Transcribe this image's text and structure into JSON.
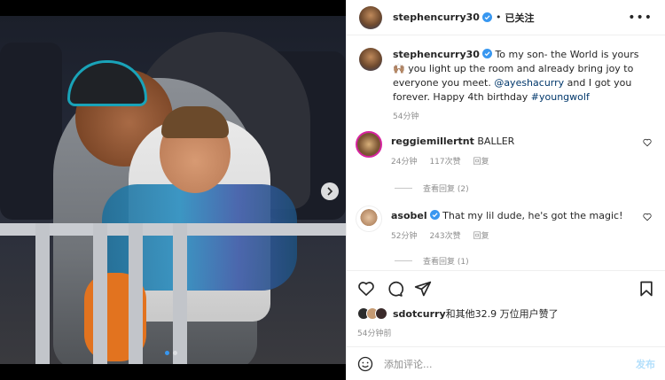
{
  "post": {
    "author": "stephencurry30",
    "separator": "•",
    "follow_status": "已关注",
    "caption": {
      "text_before": "To my son- the World is yours 🙌🏽 you light up the room and already bring joy to everyone you meet. ",
      "mention": "@ayeshacurry",
      "text_middle": " and I got you forever. Happy 4th birthday ",
      "hashtag": "#youngwolf"
    },
    "caption_time": "54分钟",
    "likes": {
      "liker": "sdotcurry",
      "rest": "和其他32.9 万位用户赞了"
    },
    "post_time": "54分钟前"
  },
  "comments": [
    {
      "username": "reggiemillertnt",
      "text": "BALLER",
      "time": "24分钟",
      "likes": "117次赞",
      "reply": "回复",
      "view_replies": "查看回复 (2)"
    },
    {
      "username": "asobel",
      "text": "That my lil dude, he's got the magic!",
      "time": "52分钟",
      "likes": "243次赞",
      "reply": "回复",
      "view_replies": "查看回复 (1)"
    }
  ],
  "composer": {
    "placeholder": "添加评论...",
    "publish_label": "发布"
  },
  "carousel": {
    "current_index": 1,
    "total": 2
  },
  "colors": {
    "link": "#00376b",
    "verified": "#3897f0",
    "publish_disabled": "#b2dffc"
  },
  "icons": [
    "more-icon",
    "verified-icon",
    "heart-icon",
    "comment-icon",
    "share-icon",
    "bookmark-icon",
    "emoji-icon",
    "chevron-right-icon"
  ]
}
